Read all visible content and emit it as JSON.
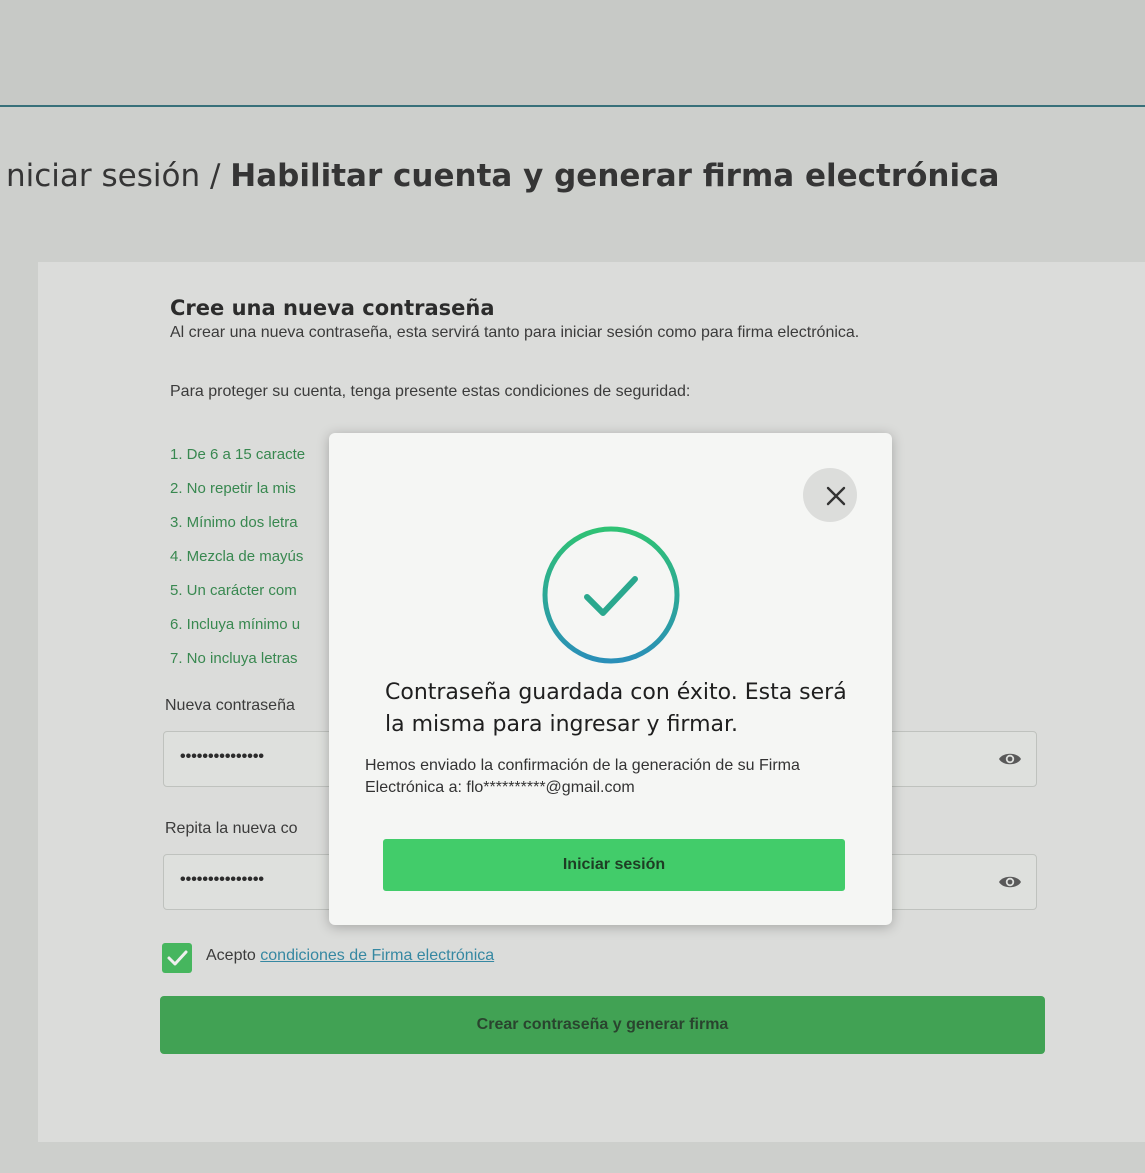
{
  "breadcrumb": {
    "parent": "niciar sesión",
    "separator": " / ",
    "current": "Habilitar cuenta y generar firma electrónica"
  },
  "form": {
    "heading": "Cree una nueva contraseña",
    "subtext": "Al crear una nueva contraseña, esta servirá tanto para iniciar sesión como para firma electrónica.",
    "security_intro": "Para proteger su cuenta, tenga presente estas condiciones de seguridad:",
    "rules": [
      "1. De 6 a 15 caracte",
      "2. No repetir la mis",
      "3. Mínimo dos letra",
      "4. Mezcla de mayús",
      "5. Un carácter com",
      "6. Incluya mínimo u",
      "7. No incluya letras"
    ],
    "new_password_label": "Nueva contraseña",
    "new_password_value": "•••••••••••••••",
    "repeat_password_label": "Repita la nueva co",
    "repeat_password_value": "•••••••••••••••",
    "accept_text": "Acepto ",
    "accept_link": "condiciones de Firma electrónica",
    "accept_checked": true,
    "submit_label": "Crear contraseña y generar firma"
  },
  "modal": {
    "title": "Contraseña guardada con éxito. Esta será la misma para ingresar y firmar.",
    "body": "Hemos enviado la confirmación de la generación de su Firma Electrónica a: flo**********@gmail.com",
    "button_label": "Iniciar sesión",
    "close_icon": "close-icon",
    "success_icon": "check-circle-icon"
  },
  "colors": {
    "accent_green": "#3aa84f",
    "rule_green": "#2f8a4a",
    "link_blue": "#2d8aa8",
    "check_gradient_start": "#2fc274",
    "check_gradient_end": "#2a8fb8"
  }
}
